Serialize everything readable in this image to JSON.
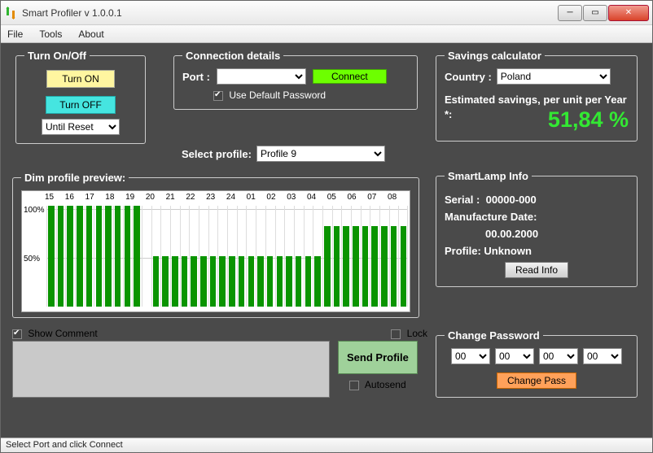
{
  "window": {
    "title": "Smart Profiler v 1.0.0.1"
  },
  "menu": {
    "file": "File",
    "tools": "Tools",
    "about": "About"
  },
  "turn": {
    "legend": "Turn On/Off",
    "on": "Turn ON",
    "off": "Turn OFF",
    "mode": "Until Reset"
  },
  "conn": {
    "legend": "Connection details",
    "port_label": "Port :",
    "port_value": "",
    "connect": "Connect",
    "use_default": "Use Default Password"
  },
  "select_profile": {
    "label": "Select profile:",
    "value": "Profile 9"
  },
  "savings": {
    "legend": "Savings calculator",
    "country_label": "Country :",
    "country_value": "Poland",
    "est_label": "Estimated savings, per unit per Year *:",
    "value": "51,84 %"
  },
  "dim": {
    "legend": "Dim profile preview:"
  },
  "comment": {
    "show": "Show Comment",
    "lock": "Lock",
    "send": "Send Profile",
    "autosend": "Autosend",
    "text": ""
  },
  "lamp": {
    "legend": "SmartLamp Info",
    "serial_label": "Serial :",
    "serial_value": "00000-000",
    "mdate_label": "Manufacture Date:",
    "mdate_value": "00.00.2000",
    "profile_label": "Profile:",
    "profile_value": "Unknown",
    "read": "Read Info"
  },
  "chpass": {
    "legend": "Change Password",
    "v1": "00",
    "v2": "00",
    "v3": "00",
    "v4": "00",
    "btn": "Change Pass"
  },
  "status": "Select Port and click Connect",
  "chart_data": {
    "type": "bar",
    "categories": [
      "15",
      "16",
      "17",
      "18",
      "19",
      "20",
      "21",
      "22",
      "23",
      "24",
      "01",
      "02",
      "03",
      "04",
      "05",
      "06",
      "07",
      "08"
    ],
    "subdivisions_per_hour": 2,
    "values_half_hour": [
      100,
      100,
      100,
      100,
      100,
      100,
      100,
      100,
      100,
      100,
      0,
      50,
      50,
      50,
      50,
      50,
      50,
      50,
      50,
      50,
      50,
      50,
      50,
      50,
      50,
      50,
      50,
      50,
      50,
      80,
      80,
      80,
      80,
      80,
      80,
      80,
      80,
      80
    ],
    "title": "",
    "xlabel": "",
    "ylabel": "",
    "ylim": [
      0,
      100
    ],
    "yticks": [
      50,
      100
    ],
    "yticklabels": [
      "50%",
      "100%"
    ]
  }
}
